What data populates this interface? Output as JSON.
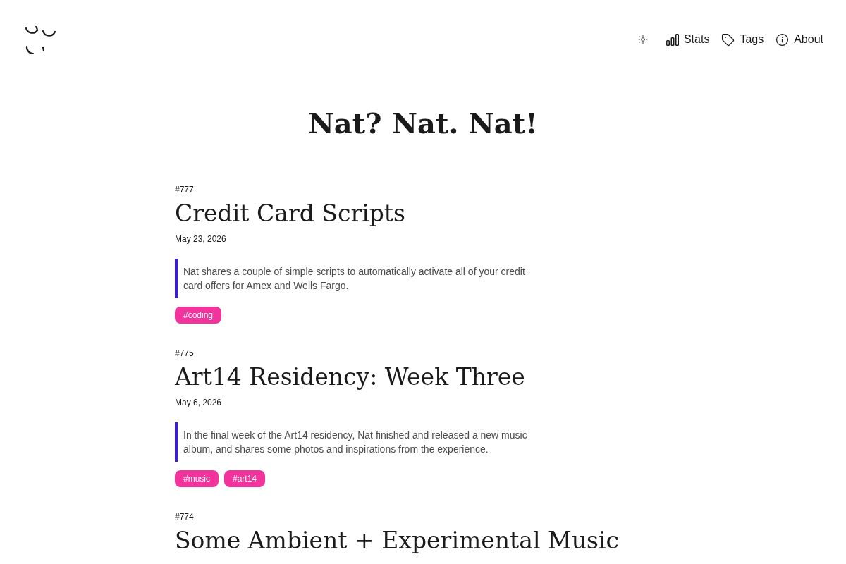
{
  "header": {
    "nav": [
      {
        "kind": "stats",
        "label": "Stats"
      },
      {
        "kind": "tags",
        "label": "Tags"
      },
      {
        "kind": "about",
        "label": "About"
      }
    ]
  },
  "site_title": "Nat? Nat. Nat!",
  "posts": [
    {
      "number": "#777",
      "title": "Credit Card Scripts",
      "date": "May 23, 2026",
      "excerpt": "Nat shares a couple of simple scripts to automatically activate all of your credit card offers for Amex and Wells Fargo.",
      "tags": [
        "#coding"
      ]
    },
    {
      "number": "#775",
      "title": "Art14 Residency: Week Three",
      "date": "May 6, 2026",
      "excerpt": "In the final week of the Art14 residency, Nat finished and released a new music album, and shares some photos and inspirations from the experience.",
      "tags": [
        "#music",
        "#art14"
      ]
    },
    {
      "number": "#774",
      "title": "Some Ambient + Experimental Music"
    }
  ]
}
